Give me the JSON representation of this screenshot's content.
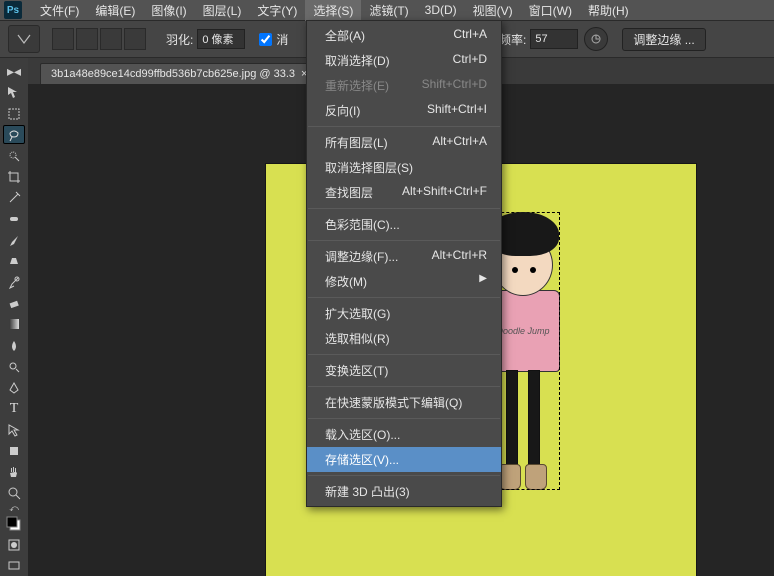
{
  "app": {
    "logo_text": "Ps"
  },
  "menubar": {
    "items": [
      {
        "label": "文件(F)"
      },
      {
        "label": "编辑(E)"
      },
      {
        "label": "图像(I)"
      },
      {
        "label": "图层(L)"
      },
      {
        "label": "文字(Y)"
      },
      {
        "label": "选择(S)",
        "active": true
      },
      {
        "label": "滤镜(T)"
      },
      {
        "label": "3D(D)"
      },
      {
        "label": "视图(V)"
      },
      {
        "label": "窗口(W)"
      },
      {
        "label": "帮助(H)"
      }
    ]
  },
  "options": {
    "feather_label": "羽化:",
    "feather_value": "0 像素",
    "antialias_label": "消",
    "freq_label": "频率:",
    "freq_value": "57",
    "refine_edge": "调整边缘 ..."
  },
  "tab": {
    "title": "3b1a48e89ce14cd99ffbd536b7cb625e.jpg @ 33.3",
    "close": "×"
  },
  "dropdown": {
    "items": [
      {
        "label": "全部(A)",
        "shortcut": "Ctrl+A"
      },
      {
        "label": "取消选择(D)",
        "shortcut": "Ctrl+D"
      },
      {
        "label": "重新选择(E)",
        "shortcut": "Shift+Ctrl+D",
        "disabled": true
      },
      {
        "label": "反向(I)",
        "shortcut": "Shift+Ctrl+I"
      },
      {
        "separator": true
      },
      {
        "label": "所有图层(L)",
        "shortcut": "Alt+Ctrl+A"
      },
      {
        "label": "取消选择图层(S)",
        "shortcut": ""
      },
      {
        "label": "查找图层",
        "shortcut": "Alt+Shift+Ctrl+F"
      },
      {
        "separator": true
      },
      {
        "label": "色彩范围(C)...",
        "shortcut": ""
      },
      {
        "separator": true
      },
      {
        "label": "调整边缘(F)...",
        "shortcut": "Alt+Ctrl+R"
      },
      {
        "label": "修改(M)",
        "shortcut": "",
        "submenu": true
      },
      {
        "separator": true
      },
      {
        "label": "扩大选取(G)",
        "shortcut": ""
      },
      {
        "label": "选取相似(R)",
        "shortcut": ""
      },
      {
        "separator": true
      },
      {
        "label": "变换选区(T)",
        "shortcut": ""
      },
      {
        "separator": true
      },
      {
        "label": "在快速蒙版模式下编辑(Q)",
        "shortcut": ""
      },
      {
        "separator": true
      },
      {
        "label": "载入选区(O)...",
        "shortcut": ""
      },
      {
        "label": "存储选区(V)...",
        "shortcut": "",
        "highlighted": true
      },
      {
        "separator": true
      },
      {
        "label": "新建 3D 凸出(3)",
        "shortcut": ""
      }
    ]
  },
  "tools": [
    "move",
    "marquee",
    "lasso",
    "quick-select",
    "crop",
    "eyedropper",
    "spot-heal",
    "brush",
    "clone",
    "history-brush",
    "eraser",
    "gradient",
    "blur",
    "dodge",
    "pen",
    "type",
    "path-select",
    "rectangle",
    "hand",
    "zoom",
    "swap",
    "swatch",
    "mask",
    "screen"
  ],
  "figure2_text": "Doodle Jump",
  "percent_suffix": "%"
}
